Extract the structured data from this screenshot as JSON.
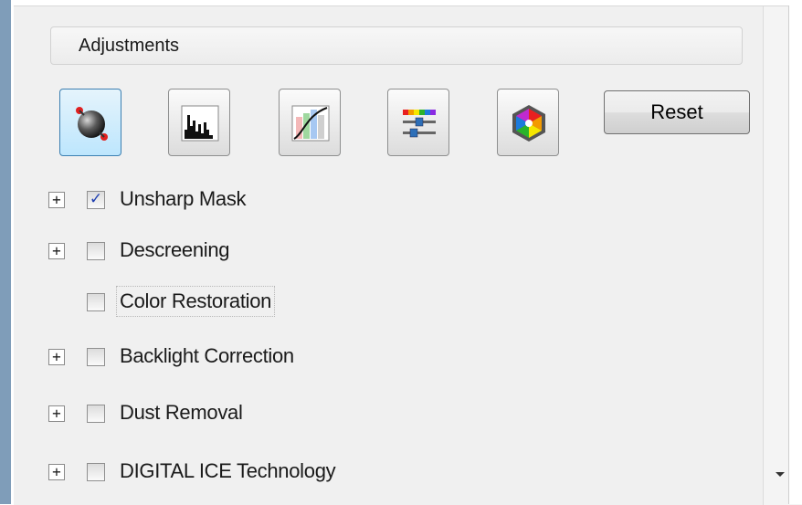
{
  "section": {
    "title": "Adjustments"
  },
  "toolbar": {
    "tools": [
      {
        "name": "Image Adjustment",
        "icon": "image-adjustment-icon",
        "active": true
      },
      {
        "name": "Histogram Adjustment",
        "icon": "histogram-icon",
        "active": false
      },
      {
        "name": "Tone Correction",
        "icon": "tone-curve-icon",
        "active": false
      },
      {
        "name": "Color Palette",
        "icon": "color-palette-icon",
        "active": false
      },
      {
        "name": "Color Wheel",
        "icon": "color-wheel-icon",
        "active": false
      }
    ],
    "reset_label": "Reset"
  },
  "options": [
    {
      "label": "Unsharp Mask",
      "checked": true,
      "expandable": true
    },
    {
      "label": "Descreening",
      "checked": false,
      "expandable": true
    },
    {
      "label": "Color Restoration",
      "checked": false,
      "expandable": false
    },
    {
      "label": "Backlight Correction",
      "checked": false,
      "expandable": true
    },
    {
      "label": "Dust Removal",
      "checked": false,
      "expandable": true
    },
    {
      "label": "DIGITAL ICE Technology",
      "checked": false,
      "expandable": true
    }
  ],
  "glyphs": {
    "expander": "+",
    "check": "✓"
  },
  "colors": {
    "active_button": "#bde6fd",
    "check_mark": "#1f3fb0",
    "window_border": "#7f9db9"
  }
}
